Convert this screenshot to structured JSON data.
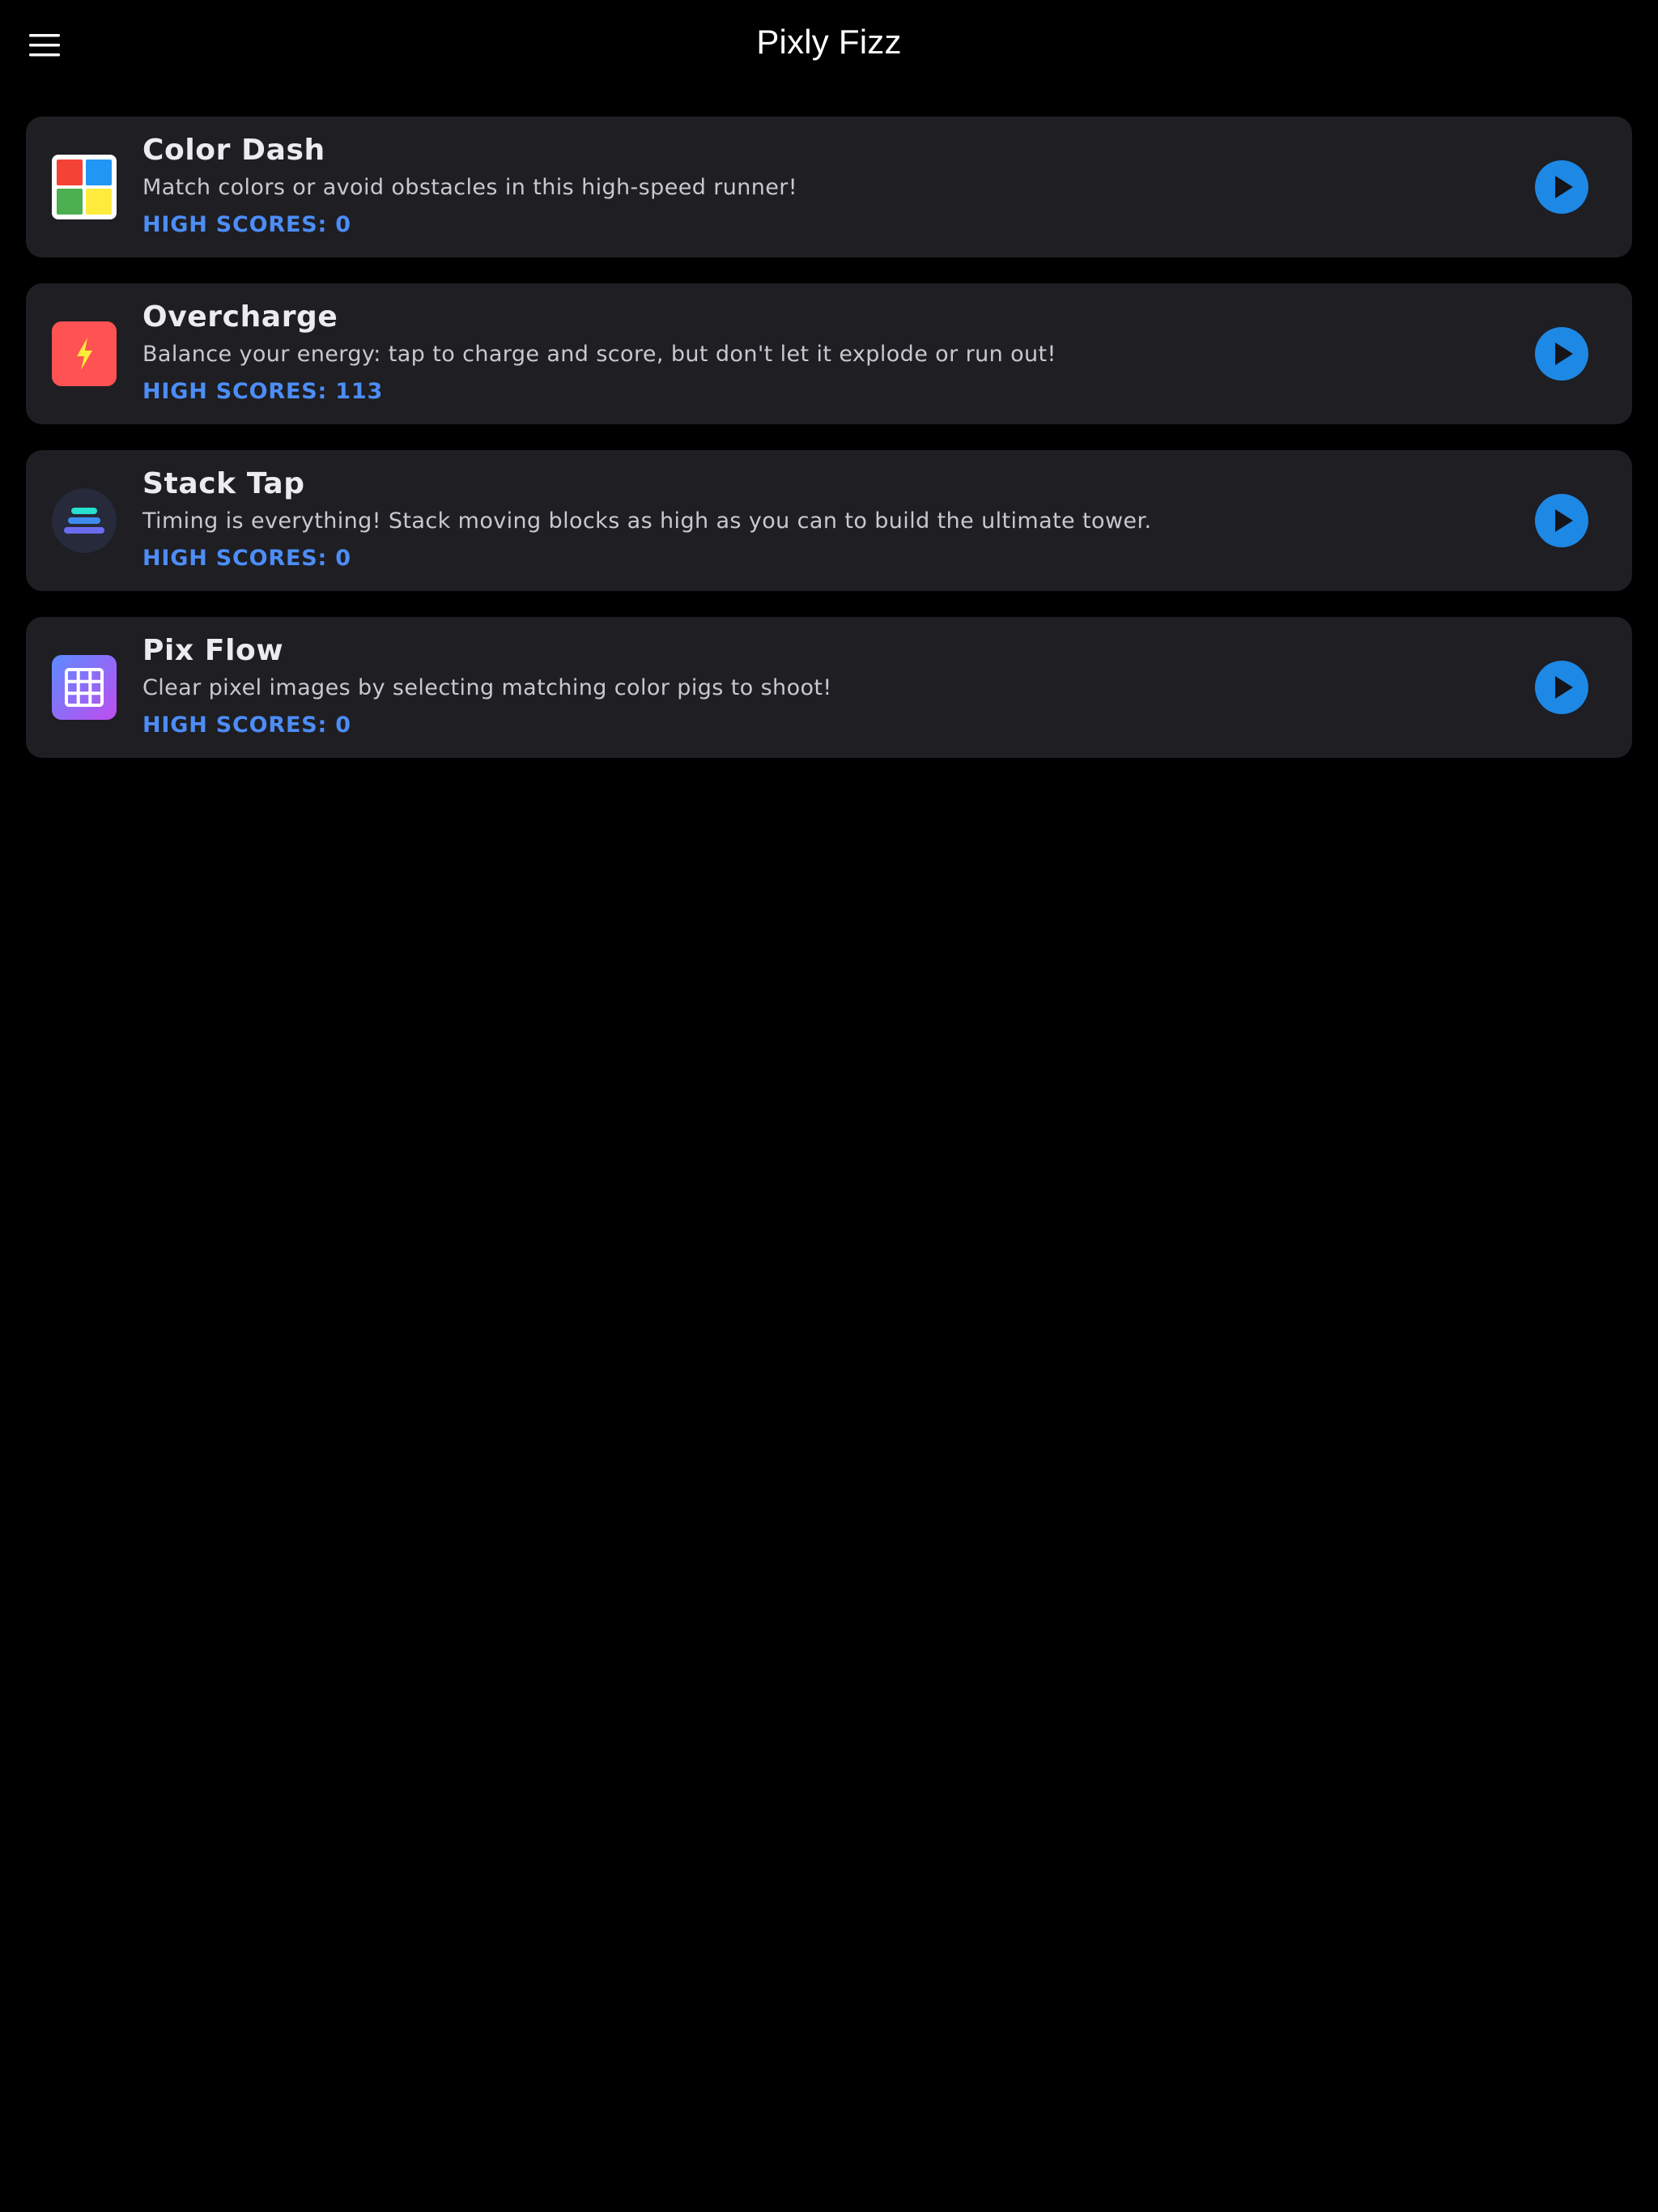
{
  "header": {
    "title": "Pixly Fizz",
    "menu_icon": "hamburger-menu-icon"
  },
  "colors": {
    "background": "#000000",
    "card": "#1e1e23",
    "accent_score": "#4d8df6",
    "play_button": "#1e88e5"
  },
  "games": [
    {
      "name": "Color Dash",
      "description": "Match colors or avoid obstacles in this high-speed runner!",
      "score_label": "HIGH SCORES:",
      "score_value": "0",
      "icon": "color-grid-icon"
    },
    {
      "name": "Overcharge",
      "description": "Balance your energy: tap to charge and score, but don't let it explode or run out!",
      "score_label": "HIGH SCORES:",
      "score_value": "113",
      "icon": "lightning-bolt-icon"
    },
    {
      "name": "Stack Tap",
      "description": "Timing is everything! Stack moving blocks as high as you can to build the ultimate tower.",
      "score_label": "HIGH SCORES:",
      "score_value": "0",
      "icon": "stacked-blocks-icon"
    },
    {
      "name": "Pix Flow",
      "description": "Clear pixel images by selecting matching color pigs to shoot!",
      "score_label": "HIGH SCORES:",
      "score_value": "0",
      "icon": "pixel-grid-icon"
    }
  ]
}
